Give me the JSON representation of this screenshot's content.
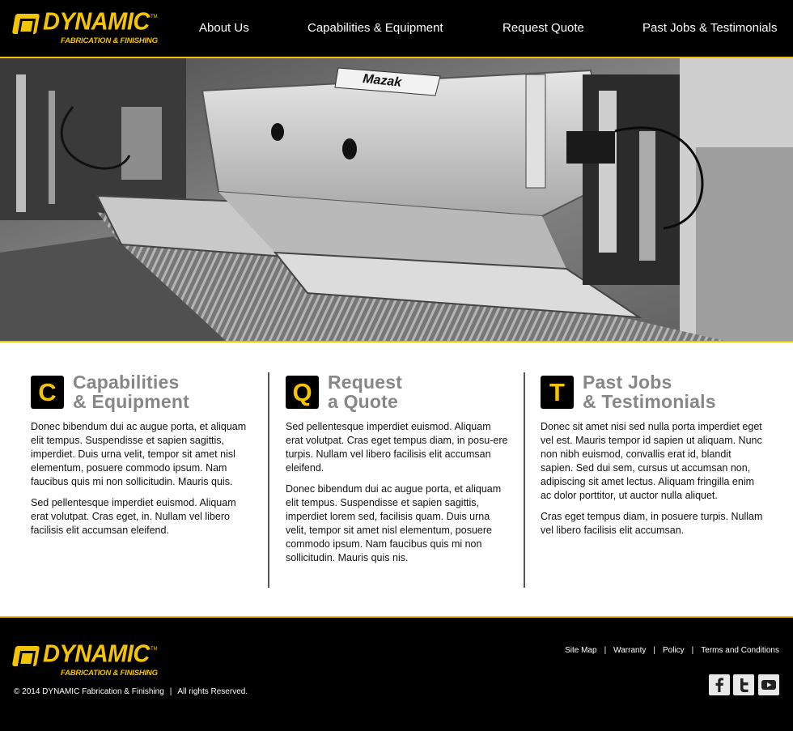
{
  "brand": {
    "name": "DYNAMIC",
    "tagline": "FABRICATION & FINISHING",
    "trademark": "TM",
    "accent_color": "#f5c400"
  },
  "nav": {
    "items": [
      {
        "label": "About Us"
      },
      {
        "label": "Capabilities & Equipment"
      },
      {
        "label": "Request Quote"
      },
      {
        "label": "Past Jobs & Testimonials"
      }
    ]
  },
  "hero": {
    "machine_label": "Mazak",
    "image": "black-and-white photo of industrial fabrication machine"
  },
  "sections": [
    {
      "letter": "C",
      "title_line1": "Capabilities",
      "title_line2": "& Equipment",
      "paragraphs": [
        "Donec bibendum dui ac augue porta, et aliquam elit tempus. Suspendisse et sapien sagittis, imperdiet. Duis urna velit, tempor sit amet nisl elementum, posuere commodo ipsum. Nam faucibus quis mi non sollicitudin. Mauris quis.",
        "Sed pellentesque imperdiet euismod. Aliquam erat volutpat. Cras eget, in. Nullam vel libero facilisis elit accumsan eleifend."
      ]
    },
    {
      "letter": "Q",
      "title_line1": "Request",
      "title_line2": "a Quote",
      "paragraphs": [
        "Sed pellentesque imperdiet euismod. Aliquam erat volutpat. Cras eget tempus diam, in posu-ere turpis. Nullam vel libero facilisis elit accumsan eleifend.",
        "Donec bibendum dui ac augue porta, et aliquam elit tempus. Suspendisse et sapien sagittis, imperdiet lorem sed, facilisis quam. Duis urna velit, tempor sit amet nisl elementum, posuere commodo ipsum. Nam faucibus quis mi non sollicitudin. Mauris quis nis."
      ]
    },
    {
      "letter": "T",
      "title_line1": "Past Jobs",
      "title_line2": "& Testimonials",
      "paragraphs": [
        "Donec sit amet nisi sed nulla porta imperdiet eget vel est. Mauris tempor id sapien ut aliquam. Nunc non nibh euismod, convallis erat id, blandit sapien. Sed dui sem, cursus ut accumsan non, adipiscing sit amet lectus. Aliquam fringilla enim ac dolor porttitor, ut auctor nulla aliquet.",
        "Cras eget tempus diam, in posuere turpis. Nullam vel libero facilisis elit accumsan."
      ]
    }
  ],
  "footer": {
    "copyright": "© 2014 DYNAMIC Fabrication & Finishing",
    "separator": "|",
    "rights": "All rights Reserved.",
    "links": [
      {
        "label": "Site Map"
      },
      {
        "label": "Warranty"
      },
      {
        "label": "Policy"
      },
      {
        "label": "Terms and Conditions"
      }
    ],
    "social": [
      {
        "icon": "facebook-icon"
      },
      {
        "icon": "twitter-icon"
      },
      {
        "icon": "youtube-icon"
      }
    ]
  }
}
